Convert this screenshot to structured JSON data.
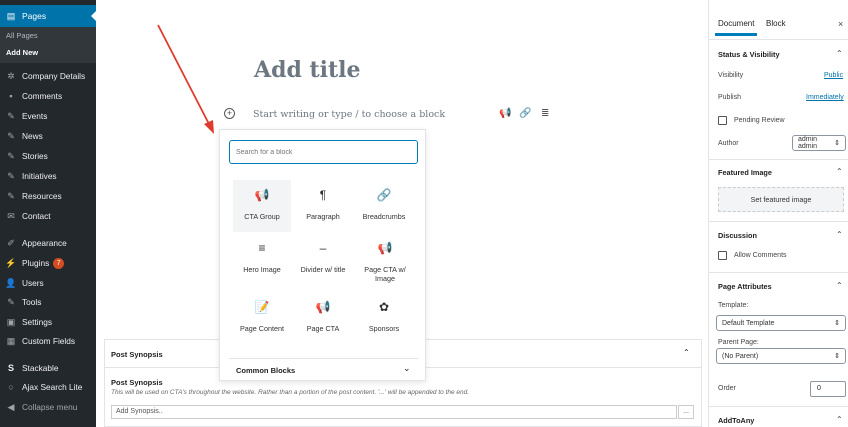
{
  "sidebar": {
    "pages_label": "Pages",
    "sub": {
      "all_pages": "All Pages",
      "add_new": "Add New"
    },
    "items": [
      {
        "label": "Company Details",
        "icon": "gear-icon"
      },
      {
        "label": "Comments",
        "icon": "comment-icon"
      },
      {
        "label": "Events",
        "icon": "pin-icon"
      },
      {
        "label": "News",
        "icon": "pin-icon"
      },
      {
        "label": "Stories",
        "icon": "pin-icon"
      },
      {
        "label": "Initiatives",
        "icon": "pin-icon"
      },
      {
        "label": "Resources",
        "icon": "pin-icon"
      },
      {
        "label": "Contact",
        "icon": "mail-icon"
      },
      {
        "label": "Appearance",
        "icon": "brush-icon"
      },
      {
        "label": "Plugins",
        "icon": "plugin-icon",
        "badge": "7"
      },
      {
        "label": "Users",
        "icon": "user-icon"
      },
      {
        "label": "Tools",
        "icon": "wrench-icon"
      },
      {
        "label": "Settings",
        "icon": "settings-icon"
      },
      {
        "label": "Custom Fields",
        "icon": "table-icon"
      },
      {
        "label": "Stackable",
        "icon": "stackable-icon"
      },
      {
        "label": "Ajax Search Lite",
        "icon": "search-icon"
      },
      {
        "label": "Collapse menu",
        "icon": "collapse-icon"
      }
    ]
  },
  "editor": {
    "title_placeholder": "Add title",
    "block_placeholder": "Start writing or type / to choose a block"
  },
  "inserter": {
    "search_placeholder": "Search for a block",
    "blocks": [
      {
        "label": "CTA Group",
        "icon": "megaphone-icon",
        "glyph": "📢"
      },
      {
        "label": "Paragraph",
        "icon": "paragraph-icon",
        "glyph": "¶"
      },
      {
        "label": "Breadcrumbs",
        "icon": "link-icon",
        "glyph": "🔗"
      },
      {
        "label": "Hero Image",
        "icon": "align-icon",
        "glyph": "≡"
      },
      {
        "label": "Divider w/ title",
        "icon": "divider-icon",
        "glyph": "–"
      },
      {
        "label": "Page CTA w/ Image",
        "icon": "megaphone-icon",
        "glyph": "📢"
      },
      {
        "label": "Page Content",
        "icon": "edit-page-icon",
        "glyph": "📝"
      },
      {
        "label": "Page CTA",
        "icon": "megaphone-icon",
        "glyph": "📢"
      },
      {
        "label": "Sponsors",
        "icon": "sponsors-icon",
        "glyph": "✿"
      }
    ],
    "category": "Common Blocks"
  },
  "metabox": {
    "title": "Post Synopsis",
    "field_label": "Post Synopsis",
    "help": "This will be used on CTA's throughout the website. Rather than a portion of the post content. '...' will be appended to the end.",
    "input_placeholder": "Add Synopsis..",
    "more_label": "..."
  },
  "panel": {
    "tabs": [
      "Document",
      "Block"
    ],
    "close": "×",
    "status": {
      "heading": "Status & Visibility",
      "visibility_label": "Visibility",
      "visibility_value": "Public",
      "publish_label": "Publish",
      "publish_value": "Immediately",
      "pending_label": "Pending Review",
      "author_label": "Author",
      "author_value": "admin admin"
    },
    "featured": {
      "heading": "Featured Image",
      "button": "Set featured image"
    },
    "discussion": {
      "heading": "Discussion",
      "allow_comments": "Allow Comments"
    },
    "attributes": {
      "heading": "Page Attributes",
      "template_label": "Template:",
      "template_value": "Default Template",
      "parent_label": "Parent Page:",
      "parent_value": "(No Parent)",
      "order_label": "Order",
      "order_value": "0"
    },
    "addtoany": {
      "heading": "AddToAny"
    }
  },
  "colors": {
    "sidebar_bg": "#23282d",
    "accent": "#0073aa",
    "arrow": "#e03a2f",
    "badge": "#d54e21"
  }
}
